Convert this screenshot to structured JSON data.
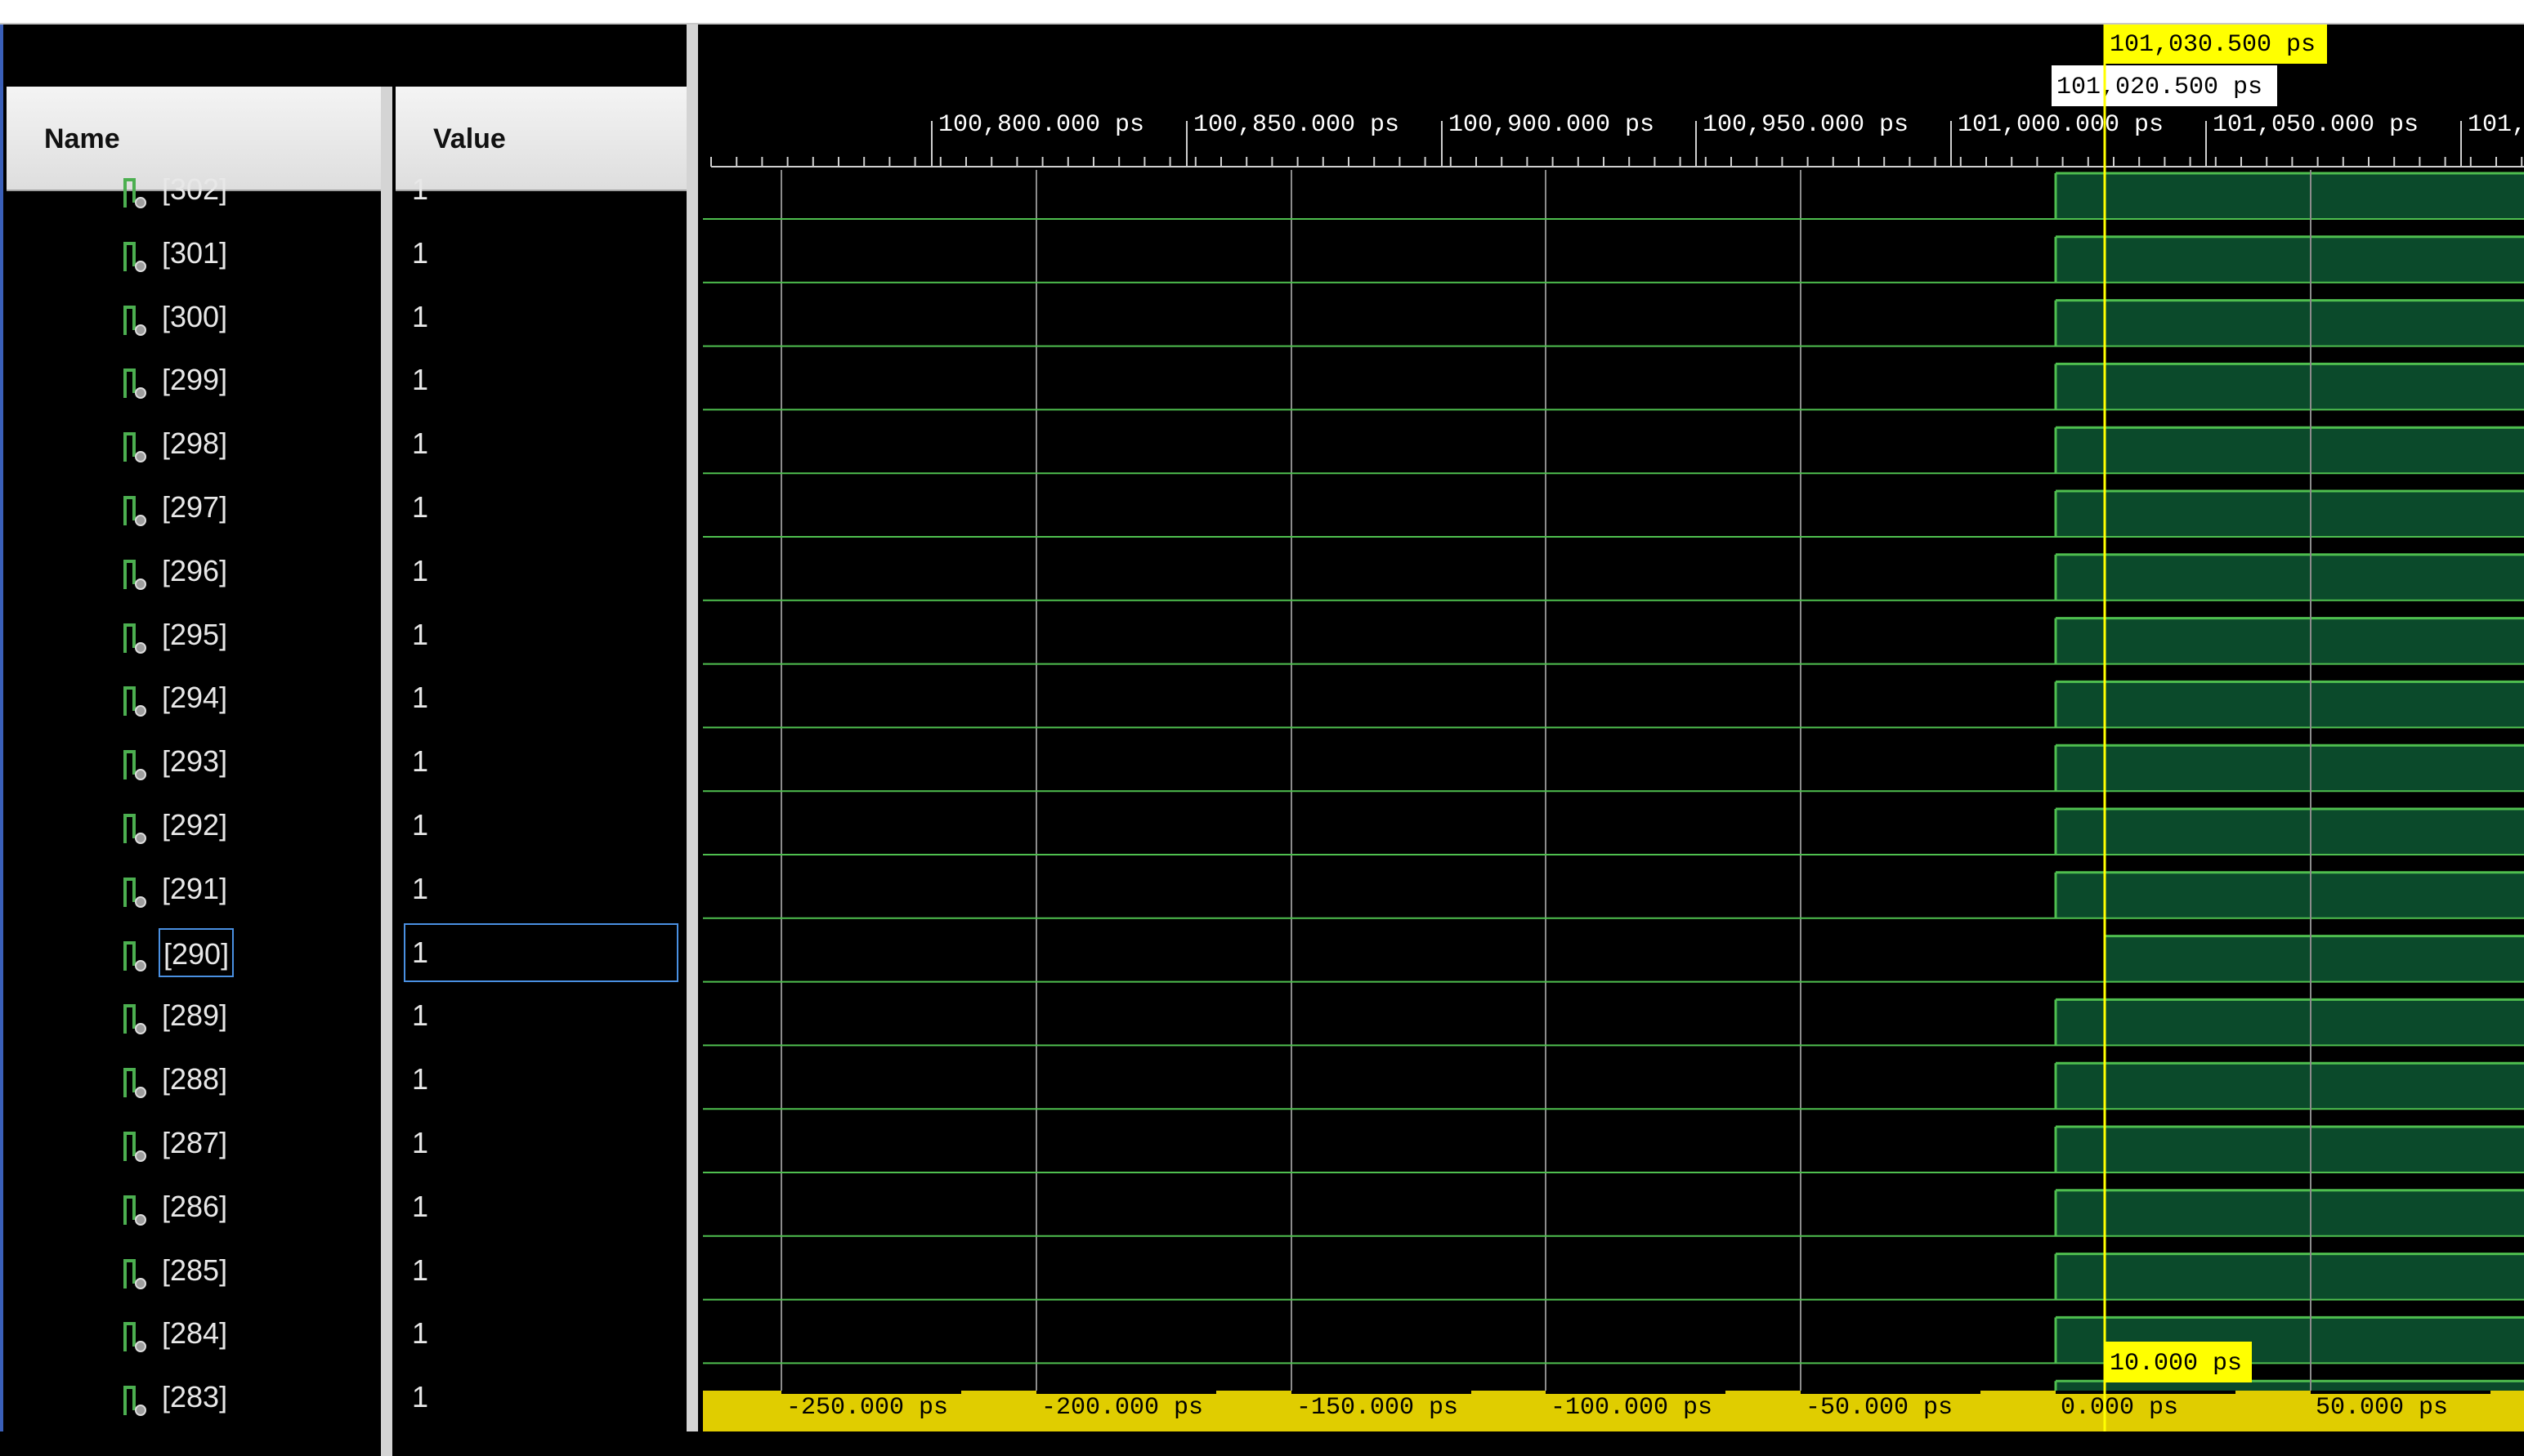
{
  "columns": {
    "name": "Name",
    "value": "Value"
  },
  "signals": [
    {
      "name": "[302]",
      "value": "1"
    },
    {
      "name": "[301]",
      "value": "1"
    },
    {
      "name": "[300]",
      "value": "1"
    },
    {
      "name": "[299]",
      "value": "1"
    },
    {
      "name": "[298]",
      "value": "1"
    },
    {
      "name": "[297]",
      "value": "1"
    },
    {
      "name": "[296]",
      "value": "1"
    },
    {
      "name": "[295]",
      "value": "1"
    },
    {
      "name": "[294]",
      "value": "1"
    },
    {
      "name": "[293]",
      "value": "1"
    },
    {
      "name": "[292]",
      "value": "1"
    },
    {
      "name": "[291]",
      "value": "1"
    },
    {
      "name": "[290]",
      "value": "1",
      "selected": true
    },
    {
      "name": "[289]",
      "value": "1"
    },
    {
      "name": "[288]",
      "value": "1"
    },
    {
      "name": "[287]",
      "value": "1"
    },
    {
      "name": "[286]",
      "value": "1"
    },
    {
      "name": "[285]",
      "value": "1"
    },
    {
      "name": "[284]",
      "value": "1"
    },
    {
      "name": "[283]",
      "value": "1"
    }
  ],
  "timeline": {
    "top_labels": [
      "100,800.000 ps",
      "100,850.000 ps",
      "100,900.000 ps",
      "100,950.000 ps",
      "101,000.000 ps",
      "101,050.000 ps",
      "101,"
    ],
    "cursor_label": "101,030.500 ps",
    "marker_label": "101,020.500 ps",
    "bottom_labels": [
      "-250.000 ps",
      "-200.000 ps",
      "-150.000 ps",
      "-100.000 ps",
      "-50.000 ps",
      "0.000 ps",
      "50.000 ps"
    ],
    "delta_label": "10.000 ps"
  },
  "colors": {
    "wave_line": "#4fbf4f",
    "wave_fill": "#0b4a2b",
    "cursor": "#ffff00",
    "grid": "#8c8c8c",
    "bottom_bar": "#e0cd00"
  }
}
